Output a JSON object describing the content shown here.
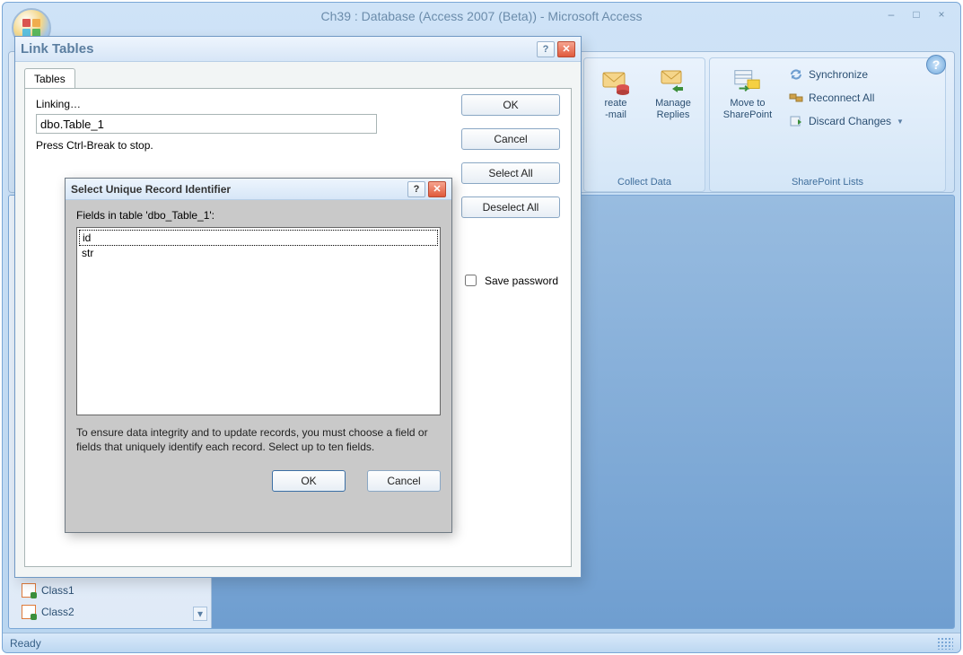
{
  "app": {
    "title": "Ch39 : Database (Access 2007 (Beta)) - Microsoft Access",
    "min": "–",
    "restore": "□",
    "close": "×"
  },
  "ribbon": {
    "groups": {
      "collect": {
        "create_label_l1": "reate",
        "create_label_l2": "-mail",
        "manage_label_l1": "Manage",
        "manage_label_l2": "Replies",
        "group_label": "Collect Data"
      },
      "sp": {
        "move_label_l1": "Move to",
        "move_label_l2": "SharePoint",
        "sync": "Synchronize",
        "reconnect": "Reconnect All",
        "discard": "Discard Changes",
        "group_label": "SharePoint Lists"
      }
    },
    "help": "?"
  },
  "nav": {
    "items": [
      "Class1",
      "Class2"
    ],
    "chev": "▾"
  },
  "status": {
    "text": "Ready"
  },
  "dlg1": {
    "title": "Link Tables",
    "tab": "Tables",
    "linking_label": "Linking…",
    "linking_value": "dbo.Table_1",
    "hint": "Press Ctrl-Break to stop.",
    "ok": "OK",
    "cancel": "Cancel",
    "select_all": "Select All",
    "deselect_all": "Deselect All",
    "save_password": "Save password",
    "help": "?",
    "close": "✕"
  },
  "dlg2": {
    "title": "Select Unique Record Identifier",
    "fields_label": "Fields in table 'dbo_Table_1':",
    "fields": [
      "id",
      "str"
    ],
    "instruction": "To ensure data integrity and to update records, you must choose a field or fields that uniquely identify each record. Select up to ten fields.",
    "ok": "OK",
    "cancel": "Cancel",
    "help": "?",
    "close": "✕"
  }
}
